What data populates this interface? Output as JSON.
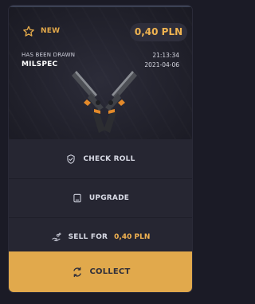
{
  "badge": {
    "new_label": "NEW",
    "price": "0,40 PLN"
  },
  "drop": {
    "status_label": "HAS BEEN DRAWN",
    "rarity": "MILSPEC",
    "time": "21:13:34",
    "date": "2021-04-06"
  },
  "actions": {
    "check_roll": "CHECK ROLL",
    "upgrade": "UPGRADE",
    "sell_for": "SELL FOR",
    "sell_price": "0,40 PLN",
    "collect": "COLLECT"
  },
  "icons": {
    "star": "star-outline-icon",
    "check_roll": "shield-check-icon",
    "upgrade": "upgrade-icon",
    "sell": "hand-coins-icon",
    "collect": "refresh-arrows-icon"
  },
  "colors": {
    "accent": "#E1A94C",
    "price": "#F0B451",
    "background": "#1B1B26",
    "card": "#23232F",
    "row": "#262632"
  }
}
